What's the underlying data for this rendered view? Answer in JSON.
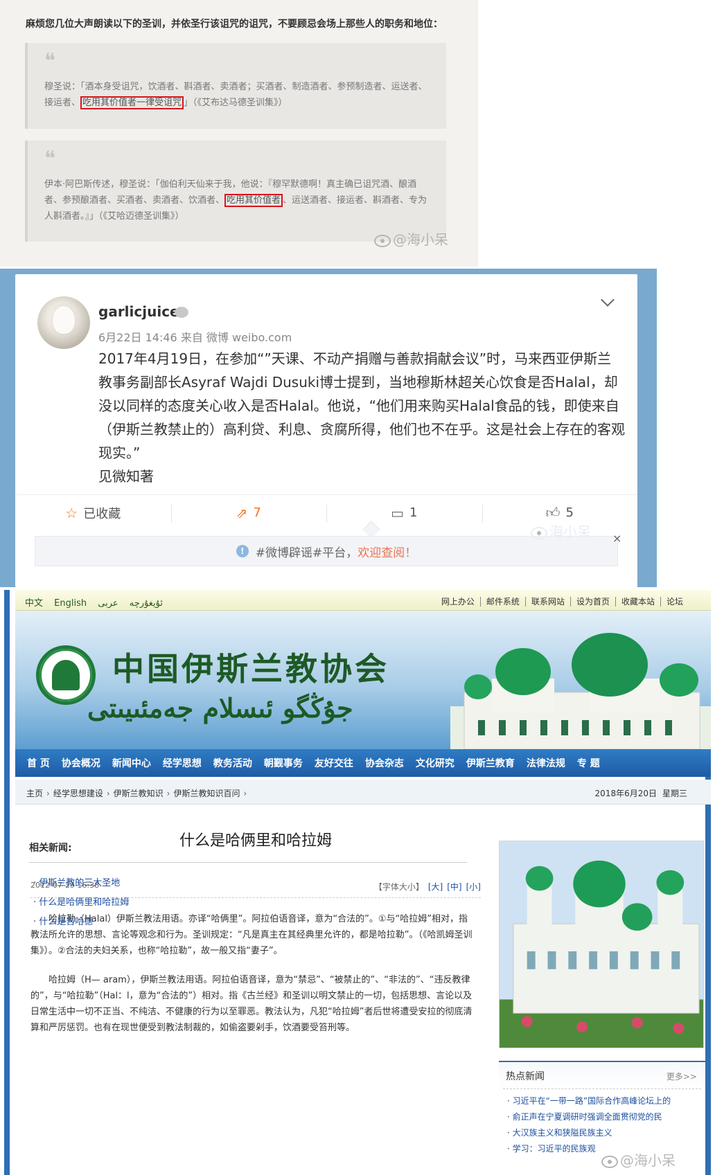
{
  "quotes_panel": {
    "intro": "麻烦您几位大声朗读以下的圣训，并依圣行该诅咒的诅咒，不要顾忌会场上那些人的职务和地位：",
    "quote1": {
      "before": "穆圣说：「酒本身受诅咒，饮酒者、斟酒者、卖酒者；买酒者、制造酒者、参预制造者、运送者、接运者、",
      "highlight": "吃用其价值者一律受诅咒",
      "after": "」（《艾布达马德圣训集》）"
    },
    "quote2": {
      "before": "伊本·阿巴斯传述，穆圣说：「伽伯利天仙来于我，他说：『穆罕默德啊！真主确已诅咒酒、酿酒者、参预酿酒者、买酒者、卖酒者、饮酒者、",
      "highlight": "吃用其价值者",
      "after": "、运送酒者、接运者、斟酒者、专为人斟酒者。』」（《艾哈迈德圣训集》）"
    },
    "watermark": "@海小呆"
  },
  "weibo_panel": {
    "username": "garlicjuice",
    "meta": "6月22日 14:46 来自 微博 weibo.com",
    "post_lines": [
      "2017年4月19日，在参加“”天课、不动产捐赠与善款捐献会议”时，马来西亚伊斯兰教事务副部长Asyraf Wajdi Dusuki博士提到，当地穆斯林超关心饮食是否Halal，却没以同样的态度关心收入是否Halal。他说，“他们用来购买Halal食品的钱，即使来自（伊斯兰教禁止的）高利贷、利息、贪腐所得，他们也不在乎。这是社会上存在的客观现实。”",
      "见微知著"
    ],
    "actions": {
      "favorite": "已收藏",
      "forward": "7",
      "comment": "1",
      "like": "5"
    },
    "rumor_bar": {
      "text": "#微博辟谣#平台，",
      "link": "欢迎查阅！",
      "close": "×"
    },
    "watermark": "海小呆"
  },
  "site_panel": {
    "languages": [
      "中文",
      "English",
      "عربى",
      "ئۇيغۇرچە"
    ],
    "top_links": [
      "网上办公",
      "邮件系统",
      "联系网站",
      "设为首页",
      "收藏本站",
      "论坛"
    ],
    "title_cn": "中国伊斯兰教协会",
    "title_ug": "جۇڭگو ئىسلام جەمئىيىتى",
    "nav": [
      "首 页",
      "协会概况",
      "新闻中心",
      "经学思想",
      "教务活动",
      "朝觐事务",
      "友好交往",
      "协会杂志",
      "文化研究",
      "伊斯兰教育",
      "法律法规",
      "专 题"
    ],
    "breadcrumb": [
      "主页",
      "经学思想建设",
      "伊斯兰教知识",
      "伊斯兰教知识百问"
    ],
    "date": "2018年6月20日",
    "weekday": "星期三",
    "article": {
      "title": "什么是哈俩里和哈拉姆",
      "time": "2012-07-29 16:38",
      "font_label": "【字体大小】",
      "font_options": [
        "[大]",
        "[中]",
        "[小]"
      ],
      "para1": "哈拉勒（Halal）伊斯兰教法用语。亦译“哈俩里”。阿拉伯语音译，意为“合法的”。①与“哈拉姆”相对，指教法所允许的思想、言论等观念和行为。圣训规定：“凡是真主在其经典里允许的，都是哈拉勒”。（《哈凯姆圣训集》）。②合法的夫妇关系，也称“哈拉勒”，故一般又指“妻子”。",
      "para2": "哈拉姆（H— aram），伊斯兰教法用语。阿拉伯语音译，意为“禁忌”、“被禁止的”、“非法的”、“违反教律的”，与“哈拉勒”（Hal：l，意为“合法的”）相对。指《古兰经》和圣训以明文禁止的一切，包括思想、言论以及日常生活中一切不正当、不纯洁、不健康的行为以至罪恶。教法认为，凡犯“哈拉姆”者后世将遭受安拉的彻底清算和严厉惩罚。也有在现世便受到教法制裁的，如偷盗要剁手，饮酒要受笞刑等。"
    },
    "related_head": "相关新闻:",
    "related": [
      "伊斯兰教的三大圣地",
      "什么是哈俩里和哈拉姆",
      "什么是吉哈德"
    ],
    "hot_head": "热点新闻",
    "hot_more": "更多>>",
    "hot": [
      "习近平在“一带一路”国际合作高峰论坛上的",
      "俞正声在宁夏调研时强调全面贯彻党的民",
      "大汉族主义和狭隘民族主义",
      "学习：习近平的民族观"
    ],
    "watermark": "@海小呆"
  }
}
